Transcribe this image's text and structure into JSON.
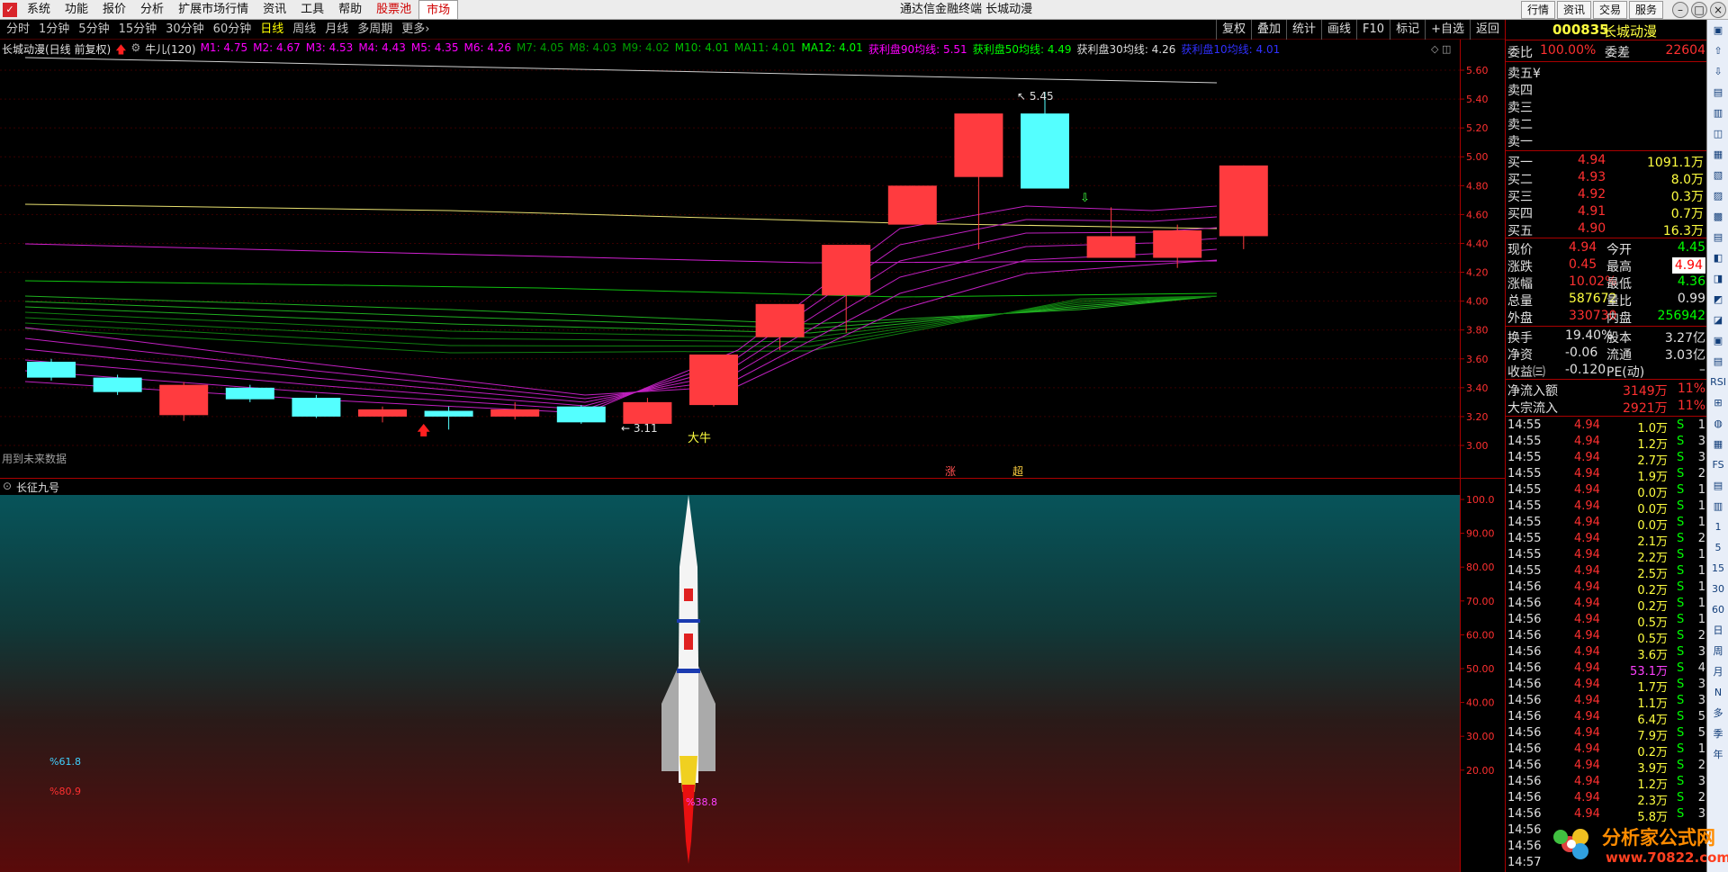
{
  "menubar": {
    "items": [
      "系统",
      "功能",
      "报价",
      "分析",
      "扩展市场行情",
      "资讯",
      "工具",
      "帮助"
    ],
    "stock_pool": "股票池",
    "market": "市场",
    "window_title": "通达信金融终端  长城动漫",
    "right_buttons": [
      "行情",
      "资讯",
      "交易",
      "服务"
    ],
    "window_buttons": [
      "–",
      "□",
      "×"
    ]
  },
  "periodbar": {
    "periods": [
      "分时",
      "1分钟",
      "5分钟",
      "15分钟",
      "30分钟",
      "60分钟",
      "日线",
      "周线",
      "月线",
      "多周期",
      "更多›"
    ],
    "active": "日线",
    "tools": [
      "复权",
      "叠加",
      "统计",
      "画线",
      "F10",
      "标记",
      "+自选",
      "返回"
    ]
  },
  "chart": {
    "title": "长城动漫(日线 前复权)",
    "indicator": "牛儿(120)",
    "legend": [
      {
        "text": "M1: 4.75",
        "color": "#ff00ff"
      },
      {
        "text": "M2: 4.67",
        "color": "#ff00ff"
      },
      {
        "text": "M3: 4.53",
        "color": "#ff00ff"
      },
      {
        "text": "M4: 4.43",
        "color": "#ff00ff"
      },
      {
        "text": "M5: 4.35",
        "color": "#ff00ff"
      },
      {
        "text": "M6: 4.26",
        "color": "#ff00ff"
      },
      {
        "text": "M7: 4.05",
        "color": "#00a000"
      },
      {
        "text": "M8: 4.03",
        "color": "#00a000"
      },
      {
        "text": "M9: 4.02",
        "color": "#00a000"
      },
      {
        "text": "M10: 4.01",
        "color": "#00c000"
      },
      {
        "text": "MA11: 4.01",
        "color": "#00c000"
      },
      {
        "text": "MA12: 4.01",
        "color": "#00ff00"
      },
      {
        "text": "获利盘90均线: 5.51",
        "color": "#ff00ff"
      },
      {
        "text": "获利盘50均线: 4.49",
        "color": "#00ff00"
      },
      {
        "text": "获利盘30均线: 4.26",
        "color": "#dddddd"
      },
      {
        "text": "获利盘10均线: 4.01",
        "color": "#3030ff"
      }
    ],
    "future_data_note": "用到未来数据",
    "annotations": {
      "high": "5.45",
      "low": "3.11",
      "bull": "大牛",
      "zhang": "涨",
      "chao": "超"
    },
    "price_ticks": [
      "5.60",
      "5.40",
      "5.20",
      "5.00",
      "4.80",
      "4.60",
      "4.40",
      "4.20",
      "4.00",
      "3.80",
      "3.60",
      "3.40",
      "3.20",
      "3.00"
    ],
    "lower_title": "长征九号",
    "lower_ticks": [
      "100.0",
      "90.00",
      "80.00",
      "70.00",
      "60.00",
      "50.00",
      "40.00",
      "30.00",
      "20.00"
    ],
    "lower_labels": {
      "a": "%61.8",
      "b": "%80.9",
      "c": "%38.8"
    }
  },
  "chart_data": {
    "type": "candlestick",
    "ylim": [
      2.9,
      5.7
    ],
    "candles": [
      {
        "o": 3.58,
        "c": 3.47,
        "h": 3.6,
        "l": 3.45
      },
      {
        "o": 3.47,
        "c": 3.37,
        "h": 3.49,
        "l": 3.35
      },
      {
        "o": 3.21,
        "c": 3.42,
        "h": 3.44,
        "l": 3.17
      },
      {
        "o": 3.4,
        "c": 3.32,
        "h": 3.42,
        "l": 3.3
      },
      {
        "o": 3.33,
        "c": 3.2,
        "h": 3.35,
        "l": 3.19
      },
      {
        "o": 3.2,
        "c": 3.25,
        "h": 3.27,
        "l": 3.16
      },
      {
        "o": 3.24,
        "c": 3.2,
        "h": 3.27,
        "l": 3.11
      },
      {
        "o": 3.2,
        "c": 3.25,
        "h": 3.3,
        "l": 3.18
      },
      {
        "o": 3.27,
        "c": 3.16,
        "h": 3.28,
        "l": 3.15
      },
      {
        "o": 3.15,
        "c": 3.3,
        "h": 3.33,
        "l": 3.11
      },
      {
        "o": 3.28,
        "c": 3.63,
        "h": 3.63,
        "l": 3.27
      },
      {
        "o": 3.75,
        "c": 3.98,
        "h": 3.98,
        "l": 3.66
      },
      {
        "o": 4.04,
        "c": 4.39,
        "h": 4.39,
        "l": 3.78
      },
      {
        "o": 4.53,
        "c": 4.8,
        "h": 4.8,
        "l": 4.53
      },
      {
        "o": 4.86,
        "c": 5.3,
        "h": 5.3,
        "l": 4.36
      },
      {
        "o": 5.3,
        "c": 4.78,
        "h": 5.45,
        "l": 4.78
      },
      {
        "o": 4.3,
        "c": 4.45,
        "h": 4.65,
        "l": 4.3
      },
      {
        "o": 4.3,
        "c": 4.49,
        "h": 4.53,
        "l": 4.23
      },
      {
        "o": 4.45,
        "c": 4.94,
        "h": 4.94,
        "l": 4.36
      }
    ],
    "indicator_value": 38.8
  },
  "quote": {
    "code": "000835",
    "name": "长城动漫",
    "weibi_label": "委比",
    "weibi": "100.00%",
    "weicha_label": "委差",
    "weicha": "22604",
    "sells": [
      {
        "label": "卖五",
        "price": "",
        "vol": "",
        "extra": "¥"
      },
      {
        "label": "卖四",
        "price": "",
        "vol": ""
      },
      {
        "label": "卖三",
        "price": "",
        "vol": ""
      },
      {
        "label": "卖二",
        "price": "",
        "vol": ""
      },
      {
        "label": "卖一",
        "price": "",
        "vol": ""
      }
    ],
    "buys": [
      {
        "label": "买一",
        "price": "4.94",
        "vol": "1091.1万"
      },
      {
        "label": "买二",
        "price": "4.93",
        "vol": "8.0万"
      },
      {
        "label": "买三",
        "price": "4.92",
        "vol": "0.3万"
      },
      {
        "label": "买四",
        "price": "4.91",
        "vol": "0.7万"
      },
      {
        "label": "买五",
        "price": "4.90",
        "vol": "16.3万"
      }
    ],
    "stats": [
      {
        "l1": "现价",
        "v1": "4.94",
        "c1": "#ff3030",
        "l2": "今开",
        "v2": "4.45",
        "c2": "#00ff00"
      },
      {
        "l1": "涨跌",
        "v1": "0.45",
        "c1": "#ff3030",
        "l2": "最高",
        "v2": "4.94",
        "c2": "#ff3030",
        "boxed": true
      },
      {
        "l1": "涨幅",
        "v1": "10.02%",
        "c1": "#ff3030",
        "l2": "最低",
        "v2": "4.36",
        "c2": "#00ff00"
      },
      {
        "l1": "总量",
        "v1": "587672",
        "c1": "#ffff40",
        "l2": "量比",
        "v2": "0.99",
        "c2": "#e0e0e0"
      },
      {
        "l1": "外盘",
        "v1": "330730",
        "c1": "#ff3030",
        "l2": "内盘",
        "v2": "256942",
        "c2": "#00ff00"
      }
    ],
    "stats2": [
      {
        "l1": "换手",
        "v1": "19.40%",
        "l2": "股本",
        "v2": "3.27亿"
      },
      {
        "l1": "净资",
        "v1": "-0.06",
        "l2": "流通",
        "v2": "3.03亿"
      },
      {
        "l1": "收益㈢",
        "v1": "-0.120",
        "l2": "PE(动)",
        "v2": "–"
      }
    ],
    "flows": [
      {
        "label": "净流入额",
        "value": "3149万",
        "pct": "11%"
      },
      {
        "label": "大宗流入",
        "value": "2921万",
        "pct": "11%"
      }
    ]
  },
  "ticks": [
    {
      "t": "14:55",
      "p": "4.94",
      "v": "1.0万",
      "s": "S",
      "n": "1"
    },
    {
      "t": "14:55",
      "p": "4.94",
      "v": "1.2万",
      "s": "S",
      "n": "3"
    },
    {
      "t": "14:55",
      "p": "4.94",
      "v": "2.7万",
      "s": "S",
      "n": "3"
    },
    {
      "t": "14:55",
      "p": "4.94",
      "v": "1.9万",
      "s": "S",
      "n": "2"
    },
    {
      "t": "14:55",
      "p": "4.94",
      "v": "0.0万",
      "s": "S",
      "n": "1"
    },
    {
      "t": "14:55",
      "p": "4.94",
      "v": "0.0万",
      "s": "S",
      "n": "1"
    },
    {
      "t": "14:55",
      "p": "4.94",
      "v": "0.0万",
      "s": "S",
      "n": "1"
    },
    {
      "t": "14:55",
      "p": "4.94",
      "v": "2.1万",
      "s": "S",
      "n": "2"
    },
    {
      "t": "14:55",
      "p": "4.94",
      "v": "2.2万",
      "s": "S",
      "n": "1"
    },
    {
      "t": "14:55",
      "p": "4.94",
      "v": "2.5万",
      "s": "S",
      "n": "1"
    },
    {
      "t": "14:56",
      "p": "4.94",
      "v": "0.2万",
      "s": "S",
      "n": "1"
    },
    {
      "t": "14:56",
      "p": "4.94",
      "v": "0.2万",
      "s": "S",
      "n": "1"
    },
    {
      "t": "14:56",
      "p": "4.94",
      "v": "0.5万",
      "s": "S",
      "n": "1"
    },
    {
      "t": "14:56",
      "p": "4.94",
      "v": "0.5万",
      "s": "S",
      "n": "2"
    },
    {
      "t": "14:56",
      "p": "4.94",
      "v": "3.6万",
      "s": "S",
      "n": "3"
    },
    {
      "t": "14:56",
      "p": "4.94",
      "v": "53.1万",
      "s": "S",
      "n": "4",
      "hl": true
    },
    {
      "t": "14:56",
      "p": "4.94",
      "v": "1.7万",
      "s": "S",
      "n": "3"
    },
    {
      "t": "14:56",
      "p": "4.94",
      "v": "1.1万",
      "s": "S",
      "n": "3"
    },
    {
      "t": "14:56",
      "p": "4.94",
      "v": "6.4万",
      "s": "S",
      "n": "5"
    },
    {
      "t": "14:56",
      "p": "4.94",
      "v": "7.9万",
      "s": "S",
      "n": "5"
    },
    {
      "t": "14:56",
      "p": "4.94",
      "v": "0.2万",
      "s": "S",
      "n": "1"
    },
    {
      "t": "14:56",
      "p": "4.94",
      "v": "3.9万",
      "s": "S",
      "n": "2"
    },
    {
      "t": "14:56",
      "p": "4.94",
      "v": "1.2万",
      "s": "S",
      "n": "3"
    },
    {
      "t": "14:56",
      "p": "4.94",
      "v": "2.3万",
      "s": "S",
      "n": "2"
    },
    {
      "t": "14:56",
      "p": "4.94",
      "v": "5.8万",
      "s": "S",
      "n": "3"
    },
    {
      "t": "14:56",
      "p": "",
      "v": "",
      "s": "",
      "n": ""
    },
    {
      "t": "14:56",
      "p": "",
      "v": "",
      "s": "",
      "n": ""
    },
    {
      "t": "14:57",
      "p": "",
      "v": "",
      "s": "",
      "n": ""
    }
  ],
  "rtools": [
    "▣",
    "⇧",
    "⇩",
    "▤",
    "▥",
    "◫",
    "▦",
    "▧",
    "▨",
    "▩",
    "▤",
    "◧",
    "◨",
    "◩",
    "◪",
    "▣",
    "▤",
    "RSI",
    "⊞",
    "◍",
    "▦",
    "FS",
    "▤",
    "▥",
    "1",
    "5",
    "15",
    "30",
    "60",
    "日",
    "周",
    "月",
    "N",
    "多",
    "季",
    "年"
  ],
  "watermark": {
    "text": "分析家公式网",
    "url": "www.70822.com"
  }
}
